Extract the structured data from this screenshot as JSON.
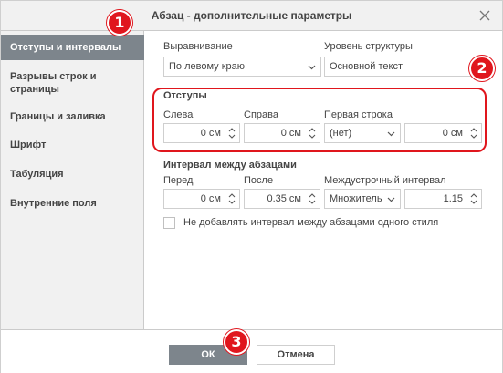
{
  "dialog": {
    "title": "Абзац - дополнительные параметры",
    "icons": {
      "close": "close-icon"
    }
  },
  "sidebar": {
    "items": [
      {
        "label": "Отступы и интервалы",
        "active": true
      },
      {
        "label": "Разрывы строк и страницы",
        "active": false
      },
      {
        "label": "Границы и заливка",
        "active": false
      },
      {
        "label": "Шрифт",
        "active": false
      },
      {
        "label": "Табуляция",
        "active": false
      },
      {
        "label": "Внутренние поля",
        "active": false
      }
    ]
  },
  "general": {
    "alignment_label": "Выравнивание",
    "alignment_value": "По левому краю",
    "outline_label": "Уровень структуры",
    "outline_value": "Основной текст"
  },
  "indents": {
    "title": "Отступы",
    "left_label": "Слева",
    "left_value": "0 см",
    "right_label": "Справа",
    "right_value": "0 см",
    "first_line_label": "Первая строка",
    "first_line_value": "(нет)",
    "first_line_amount": "0 см"
  },
  "spacing": {
    "title": "Интервал между абзацами",
    "before_label": "Перед",
    "before_value": "0 см",
    "after_label": "После",
    "after_value": "0.35 см",
    "line_spacing_label": "Междустрочный интервал",
    "line_spacing_type": "Множитель",
    "line_spacing_value": "1.15",
    "no_space_same_style_label": "Не добавлять интервал между абзацами одного стиля",
    "no_space_same_style_checked": false
  },
  "footer": {
    "ok_label": "ОК",
    "cancel_label": "Отмена"
  },
  "annotations": {
    "badge_1": "1",
    "badge_2": "2",
    "badge_3": "3",
    "color": "#e0161d"
  },
  "colors": {
    "accent": "#7d858c",
    "panel": "#f1f1f1",
    "border": "#cfcfcf"
  }
}
